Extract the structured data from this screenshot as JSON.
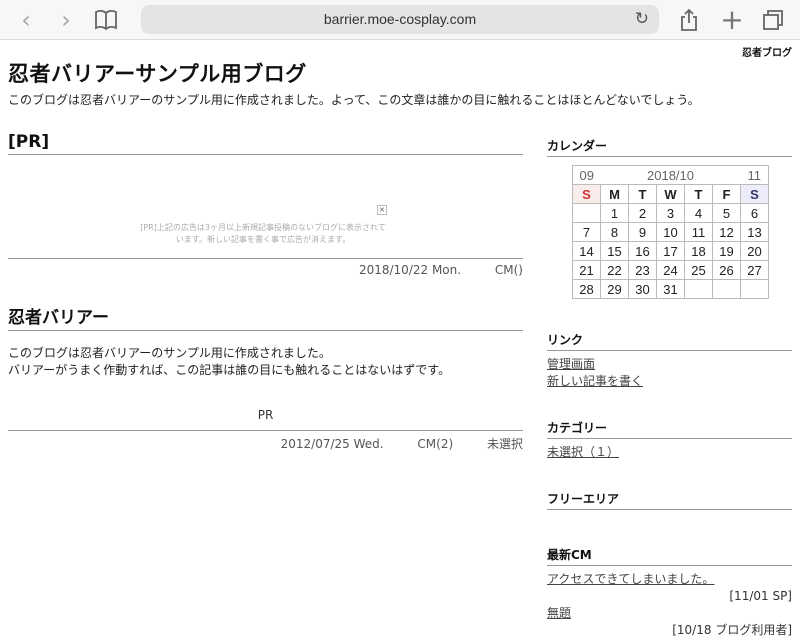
{
  "browser": {
    "url": "barrier.moe-cosplay.com"
  },
  "corner_logo": "忍者ブログ",
  "blog": {
    "title": "忍者バリアーサンプル用ブログ",
    "description": "このブログは忍者バリアーのサンプル用に作成されました。よって、この文章は誰かの目に触れることはほとんどないでしょう。"
  },
  "pr_entry": {
    "title": "[PR]",
    "ad_notice": "[PR]上記の広告は3ヶ月以上新規記事投稿のないブログに表示されています。新しい記事を書く事で広告が消えます。",
    "date": "2018/10/22 Mon.",
    "comments": "CM()"
  },
  "entry": {
    "title": "忍者バリアー",
    "body_line1": "このブログは忍者バリアーのサンプル用に作成されました。",
    "body_line2": "バリアーがうまく作動すれば、この記事は誰の目にも触れることはないはずです。",
    "pr_label": "PR",
    "date": "2012/07/25 Wed.",
    "comments": "CM(2)",
    "category": "未選択"
  },
  "sidebar": {
    "calendar": {
      "title": "カレンダー",
      "prev": "09",
      "current": "2018/10",
      "next": "11",
      "weekdays": [
        "S",
        "M",
        "T",
        "W",
        "T",
        "F",
        "S"
      ],
      "weeks": [
        [
          "",
          "1",
          "2",
          "3",
          "4",
          "5",
          "6"
        ],
        [
          "7",
          "8",
          "9",
          "10",
          "11",
          "12",
          "13"
        ],
        [
          "14",
          "15",
          "16",
          "17",
          "18",
          "19",
          "20"
        ],
        [
          "21",
          "22",
          "23",
          "24",
          "25",
          "26",
          "27"
        ],
        [
          "28",
          "29",
          "30",
          "31",
          "",
          "",
          ""
        ]
      ]
    },
    "links": {
      "title": "リンク",
      "items": [
        "管理画面",
        "新しい記事を書く"
      ]
    },
    "categories": {
      "title": "カテゴリー",
      "items": [
        "未選択（１）"
      ]
    },
    "free_area": {
      "title": "フリーエリア"
    },
    "recent_comments": {
      "title": "最新CM",
      "items": [
        {
          "text": "アクセスできてしまいました。",
          "meta": "[11/01 SP]"
        },
        {
          "text": "無題",
          "meta": "[10/18 ブログ利用者]"
        }
      ]
    }
  }
}
